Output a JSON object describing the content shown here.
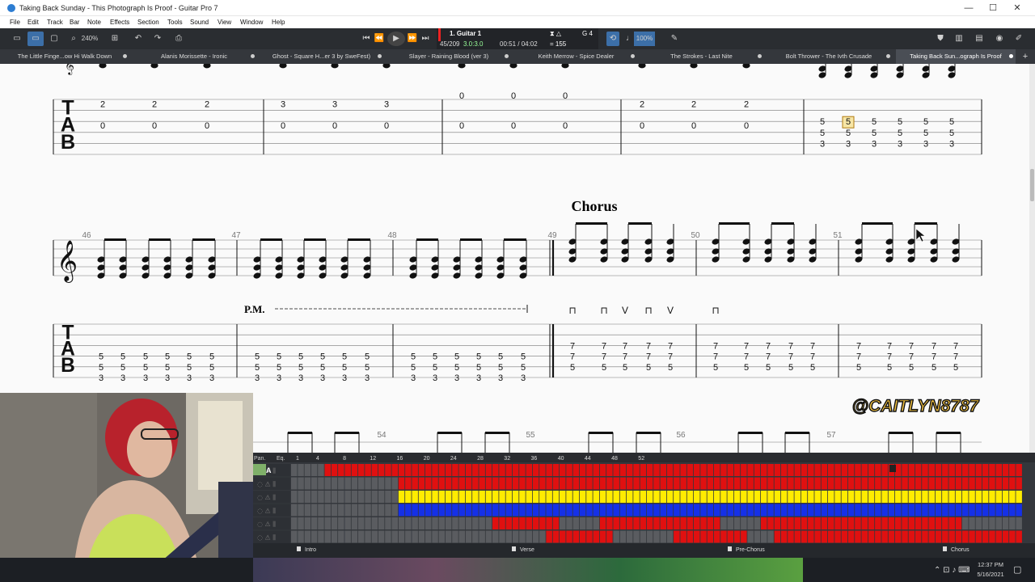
{
  "window": {
    "title": "Taking Back Sunday - This Photograph Is Proof - Guitar Pro 7",
    "controls": [
      "—",
      "☐",
      "✕"
    ]
  },
  "menu": [
    "File",
    "Edit",
    "Track",
    "Bar",
    "Note",
    "Effects",
    "Section",
    "Tools",
    "Sound",
    "View",
    "Window",
    "Help"
  ],
  "toolbar": {
    "zoom": "240%",
    "transport": {
      "track_name": "1. Guitar 1",
      "bar_position": "45/209",
      "time_signature": "3.0:3.0",
      "time": "00:51 / 04:02",
      "tempo": "= 155",
      "key": "G 4",
      "speed": "100%"
    }
  },
  "tabs": [
    {
      "label": "The Little Finge...ow Hi Walk Down",
      "active": false
    },
    {
      "label": "Alanis Morissette - Ironic",
      "active": false
    },
    {
      "label": "Ghost - Square H...er 3 by SweFest)",
      "active": false
    },
    {
      "label": "Slayer - Raining Blood (ver 3)",
      "active": false
    },
    {
      "label": "Keith Merrow - Spice Dealer",
      "active": false
    },
    {
      "label": "The Strokes - Last Nite",
      "active": false
    },
    {
      "label": "Bolt Thrower - The Ivth Crusade",
      "active": false
    },
    {
      "label": "Taking Back Sun...ograph Is Proof",
      "active": true
    }
  ],
  "score": {
    "section_title": "Chorus",
    "palm_mute": "P.M.",
    "tab_clef": [
      "T",
      "A",
      "B"
    ],
    "row1_tab": [
      {
        "cols": [
          [
            "2",
            "0"
          ],
          [
            "2",
            "0"
          ],
          [
            "2",
            "0"
          ]
        ]
      },
      {
        "cols": [
          [
            "3",
            "0"
          ],
          [
            "3",
            "0"
          ],
          [
            "3",
            "0"
          ]
        ]
      },
      {
        "cols": [
          [
            "0",
            "0"
          ],
          [
            "0",
            "0"
          ],
          [
            "0",
            "0"
          ]
        ]
      },
      {
        "cols": [
          [
            "2",
            "0"
          ],
          [
            "2",
            "0"
          ],
          [
            "2",
            "0"
          ]
        ]
      },
      {
        "cols": [
          [
            "5",
            "5",
            "3"
          ],
          [
            "5",
            "5",
            "3"
          ],
          [
            "5",
            "5",
            "3"
          ],
          [
            "5",
            "5",
            "3"
          ],
          [
            "5",
            "5",
            "3"
          ],
          [
            "5",
            "5",
            "3"
          ]
        ]
      }
    ],
    "bar_numbers_row2": [
      "46",
      "47",
      "48",
      "49",
      "50",
      "51"
    ],
    "row2_tab": {
      "pm_chord": [
        "5",
        "5",
        "3"
      ],
      "chorus_chord": [
        "7",
        "7",
        "5"
      ]
    },
    "bar_numbers_row3": [
      "54",
      "55",
      "56",
      "57"
    ],
    "watermark": "@CAITLYN8787"
  },
  "tracks": {
    "headers": [
      "Pan.",
      "Eq."
    ],
    "ruler": [
      "1",
      "4",
      "8",
      "12",
      "16",
      "20",
      "24",
      "28",
      "32",
      "36",
      "40",
      "44",
      "48",
      "52"
    ],
    "rows": [
      "red",
      "red",
      "yellow",
      "blue",
      "red",
      "red"
    ],
    "markers": [
      "Intro",
      "Verse",
      "Pre-Chorus",
      "Chorus"
    ],
    "colors": {
      "red": "#e01010",
      "yellow": "#ffec00",
      "blue": "#1530e8",
      "empty": "#5a5c60"
    }
  },
  "taskbar": {
    "time": "12:37 PM",
    "date": "5/16/2021"
  }
}
